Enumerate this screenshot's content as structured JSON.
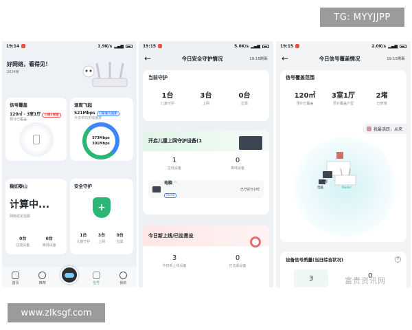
{
  "watermarks": {
    "tg": "TG: MYYJJPP",
    "url": "www.zlksgf.com",
    "bottom": "富贵资讯网"
  },
  "status": {
    "s1": {
      "time": "19:14",
      "net": "1.9K/s"
    },
    "s2": {
      "time": "19:15",
      "net": "5.0K/s"
    },
    "s3": {
      "time": "19:15",
      "net": "2.0K/s"
    }
  },
  "screen1": {
    "headline": "好网络，看得见！",
    "year": "2024家",
    "signal_card": {
      "title": "信号覆盖",
      "value": "120㎡ · 3室1厅",
      "badge": "已覆3楼帽",
      "sub": "预计已覆盖"
    },
    "speed_card": {
      "title": "速度飞起",
      "value": "521Mbps",
      "badge": "可查看光路图",
      "sub": "今日平均无线速率",
      "gauge_top": "573Mbps",
      "gauge_bottom": "301Mbps"
    },
    "stable_card": {
      "title": "稳如泰山",
      "big": "计算中...",
      "sub": "网络稳定指数",
      "stats": [
        {
          "v": "0台",
          "l": "在线设备"
        },
        {
          "v": "0台",
          "l": "离线设备"
        }
      ]
    },
    "guard_card": {
      "title": "安全守护",
      "stats": [
        {
          "v": "1台",
          "l": "儿童守护"
        },
        {
          "v": "3台",
          "l": "上网"
        },
        {
          "v": "0台",
          "l": "拉黑"
        }
      ]
    },
    "nav": [
      "首页",
      "推荐",
      "",
      "信号",
      "我的"
    ]
  },
  "screen2": {
    "title": "今日安全守护情况",
    "refresh": "19:15刷新",
    "current": {
      "title": "当前守护",
      "stats": [
        {
          "v": "1台",
          "l": "儿童守护"
        },
        {
          "v": "3台",
          "l": "上网"
        },
        {
          "v": "0台",
          "l": "拉黑"
        }
      ]
    },
    "child": {
      "title": "开启儿童上网守护设备(1",
      "stats": [
        {
          "v": "1",
          "l": "在线设备"
        },
        {
          "v": "0",
          "l": "离线设备"
        }
      ],
      "device": {
        "name": "电脑",
        "band": "5GHz",
        "status": "已守护3小时"
      }
    },
    "newdev": {
      "title": "今日新上线/已拉黑设",
      "stats": [
        {
          "v": "3",
          "l": "今日新上线设备"
        },
        {
          "v": "0",
          "l": "已拉黑设备"
        }
      ]
    }
  },
  "screen3": {
    "title": "今日信号覆盖情况",
    "refresh": "19:15刷新",
    "coverage": {
      "title": "信号覆盖范围",
      "stats": [
        {
          "v": "120㎡",
          "l": "预计已覆盖"
        },
        {
          "v": "3室1厅",
          "l": "预计覆盖户型"
        },
        {
          "v": "2堵",
          "l": "已穿墙"
        }
      ]
    },
    "bubble": "我最活跃，从来",
    "map_labels": {
      "tv": "电视",
      "pc": "电脑",
      "router": "Router"
    },
    "quality": {
      "title": "设备信号质量(当日综合状况)",
      "value": "3",
      "value2": "0"
    }
  }
}
